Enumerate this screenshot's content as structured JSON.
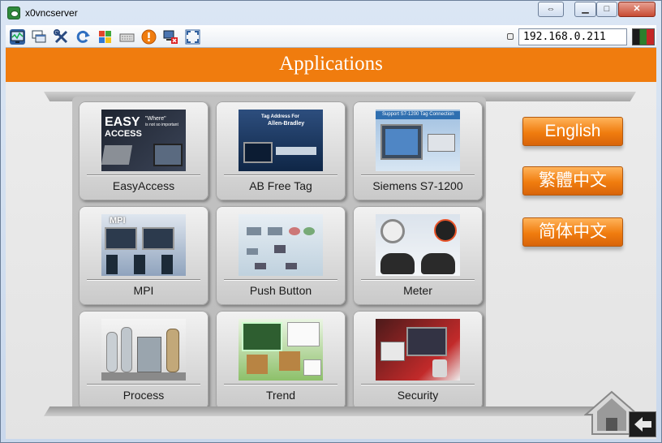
{
  "window": {
    "title": "x0vncserver",
    "icon": "vnc-eye-icon",
    "buttons": [
      {
        "name": "resize-button",
        "glyph": "⇔"
      },
      {
        "name": "minimize-button",
        "glyph": "▁"
      },
      {
        "name": "maximize-button",
        "glyph": "□"
      },
      {
        "name": "close-button",
        "glyph": "✕"
      }
    ]
  },
  "toolbar": {
    "icons": [
      "monitor-icon",
      "windows-icon",
      "tools-icon",
      "refresh-icon",
      "windows-flag-icon",
      "keyboard-icon",
      "alert-icon",
      "disconnect-icon",
      "fullscreen-icon"
    ],
    "ip_address": "192.168.0.211"
  },
  "header": {
    "title": "Applications"
  },
  "apps": [
    {
      "label": "EasyAccess"
    },
    {
      "label": "AB Free Tag"
    },
    {
      "label": "Siemens S7-1200"
    },
    {
      "label": "MPI"
    },
    {
      "label": "Push Button"
    },
    {
      "label": "Meter"
    },
    {
      "label": "Process"
    },
    {
      "label": "Trend"
    },
    {
      "label": "Security"
    }
  ],
  "thumbnails": {
    "easyaccess": {
      "line1": "EASY",
      "line2": "ACCESS",
      "tag1": "\"Where\"",
      "tag2": "is not so important"
    },
    "abfreetag": {
      "line1": "Tag Address For",
      "line2": "Allen-Bradley"
    },
    "siemens": {
      "line1": "Support S7-1200 Tag Connection"
    },
    "mpi": {
      "line1": "MPI"
    }
  },
  "languages": [
    {
      "label": "English"
    },
    {
      "label": "繁體中文"
    },
    {
      "label": "简体中文"
    }
  ],
  "colors": {
    "accent": "#f07c0e",
    "header_text": "#ffffff"
  }
}
